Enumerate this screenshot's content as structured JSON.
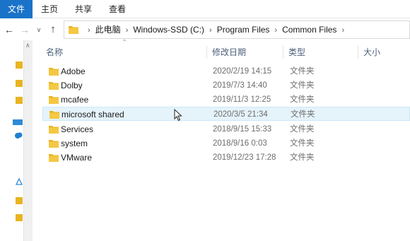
{
  "ribbon": {
    "tabs": [
      "文件",
      "主页",
      "共享",
      "查看"
    ]
  },
  "address": {
    "crumbs": [
      "此电脑",
      "Windows-SSD (C:)",
      "Program Files",
      "Common Files"
    ],
    "nav_icons": [
      "arrow-left-icon",
      "arrow-right-icon",
      "chevron-down-icon",
      "arrow-up-icon"
    ]
  },
  "columns": {
    "name": "名称",
    "date": "修改日期",
    "type": "类型",
    "size": "大小"
  },
  "files": [
    {
      "name": "Adobe",
      "date": "2020/2/19 14:15",
      "type": "文件夹"
    },
    {
      "name": "Dolby",
      "date": "2019/7/3 14:40",
      "type": "文件夹"
    },
    {
      "name": "mcafee",
      "date": "2019/11/3 12:25",
      "type": "文件夹"
    },
    {
      "name": "microsoft shared",
      "date": "2020/3/5 21:34",
      "type": "文件夹"
    },
    {
      "name": "Services",
      "date": "2018/9/15 15:33",
      "type": "文件夹"
    },
    {
      "name": "system",
      "date": "2018/9/16 0:03",
      "type": "文件夹"
    },
    {
      "name": "VMware",
      "date": "2019/12/23 17:28",
      "type": "文件夹"
    }
  ],
  "colors": {
    "accent": "#1a73c8",
    "folder": "#e8b422",
    "hover_row": "#e5f3fb"
  }
}
